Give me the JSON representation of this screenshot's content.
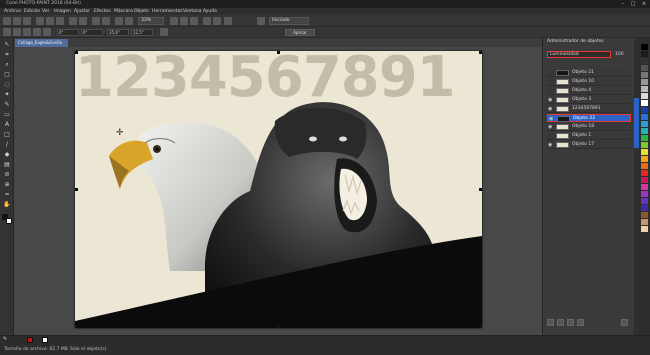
{
  "window": {
    "title": "Corel PHOTO-PAINT 2018 (64-Bit)"
  },
  "menu": [
    "Archivo",
    "Edición",
    "Ver",
    "Imagen",
    "Ajustar",
    "Efectos",
    "Máscara",
    "Objeto",
    "Herramientas",
    "Ventana",
    "Ayuda"
  ],
  "toolbar": {
    "zoom": "33%",
    "mode": "Iniciado"
  },
  "propbar": {
    "x_value": "0\"",
    "y_value": "0\"",
    "w_value": "35,6\"",
    "h_value": "12,5\"",
    "apply_label": "Aplicar"
  },
  "document": {
    "tab_label": "Collage_Eagle&Gorilla"
  },
  "canvas": {
    "numbers_text": "1234567891"
  },
  "objects_docker": {
    "title": "Administrador de objetos",
    "blend_mode": "Luminosidad",
    "opacity": "100",
    "layers": [
      {
        "name": "Objeto 21",
        "visible": false,
        "selected": false,
        "thumb": "dark"
      },
      {
        "name": "Objeto 10",
        "visible": false,
        "selected": false,
        "thumb": "light"
      },
      {
        "name": "Objeto 4",
        "visible": false,
        "selected": false,
        "thumb": "light"
      },
      {
        "name": "Objeto 3",
        "visible": true,
        "selected": false,
        "thumb": "light"
      },
      {
        "name": "1234567891",
        "visible": true,
        "selected": false,
        "thumb": "light"
      },
      {
        "name": "Objeto 22",
        "visible": true,
        "selected": true,
        "thumb": "dark"
      },
      {
        "name": "Objeto 18",
        "visible": true,
        "selected": false,
        "thumb": "light"
      },
      {
        "name": "Objeto 1",
        "visible": false,
        "selected": false,
        "thumb": "light"
      },
      {
        "name": "Objeto 17",
        "visible": true,
        "selected": false,
        "thumb": "light"
      }
    ]
  },
  "status": {
    "file_size": "Tamaño de archivo: 62.7 MB",
    "selection": "Sólo el objeto(s)"
  },
  "colors": {
    "accent": "#2b63c7",
    "highlight": "#e33333",
    "fill": "#c2140f",
    "outline": "#ffffff"
  }
}
